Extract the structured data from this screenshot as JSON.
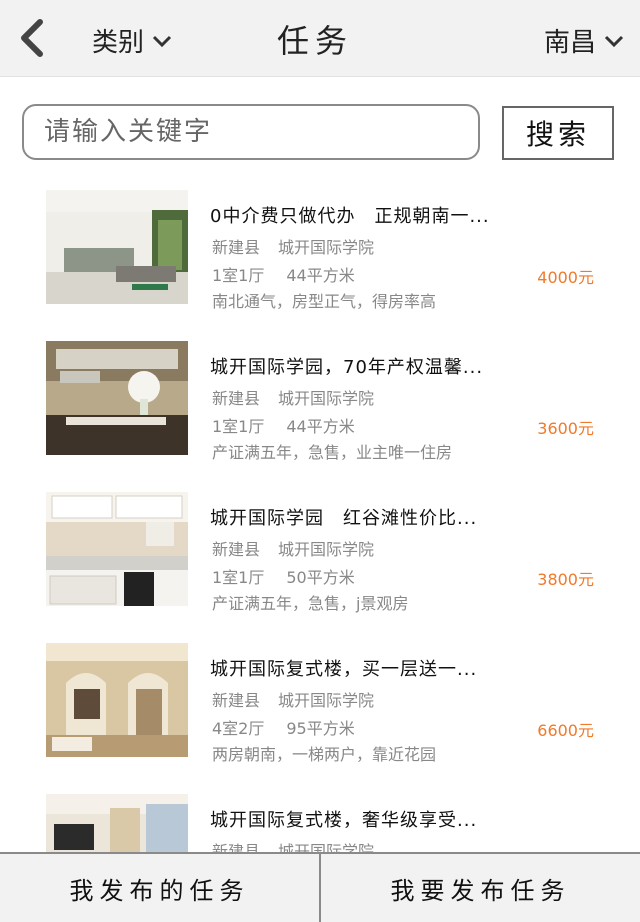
{
  "header": {
    "category_label": "类别",
    "title": "任务",
    "city_label": "南昌"
  },
  "search": {
    "placeholder": "请输入关键字",
    "button_label": "搜索"
  },
  "listings": [
    {
      "title": "0中介费只做代办　正规朝南一...",
      "county": "新建县",
      "school": "城开国际学院",
      "layout": "1室1厅",
      "area": "44平方米",
      "price": "4000元",
      "desc": "南北通气，房型正气，得房率高"
    },
    {
      "title": "城开国际学园，70年产权温馨...",
      "county": "新建县",
      "school": "城开国际学院",
      "layout": "1室1厅",
      "area": "44平方米",
      "price": "3600元",
      "desc": "产证满五年，急售，业主唯一住房"
    },
    {
      "title": "城开国际学园　红谷滩性价比...",
      "county": "新建县",
      "school": "城开国际学院",
      "layout": "1室1厅",
      "area": "50平方米",
      "price": "3800元",
      "desc": "产证满五年，急售，j景观房"
    },
    {
      "title": "城开国际复式楼，买一层送一...",
      "county": "新建县",
      "school": "城开国际学院",
      "layout": "4室2厅",
      "area": "95平方米",
      "price": "6600元",
      "desc": "两房朝南，一梯两户，靠近花园"
    },
    {
      "title": "城开国际复式楼，奢华级享受...",
      "county": "新建县",
      "school": "城开国际学院",
      "layout": "",
      "area": "",
      "price": "",
      "desc": ""
    }
  ],
  "footer": {
    "my_tasks_label": "我发布的任务",
    "publish_label": "我要发布任务"
  },
  "colors": {
    "price": "#f07a2a",
    "header_bg": "#f2f2f2"
  }
}
